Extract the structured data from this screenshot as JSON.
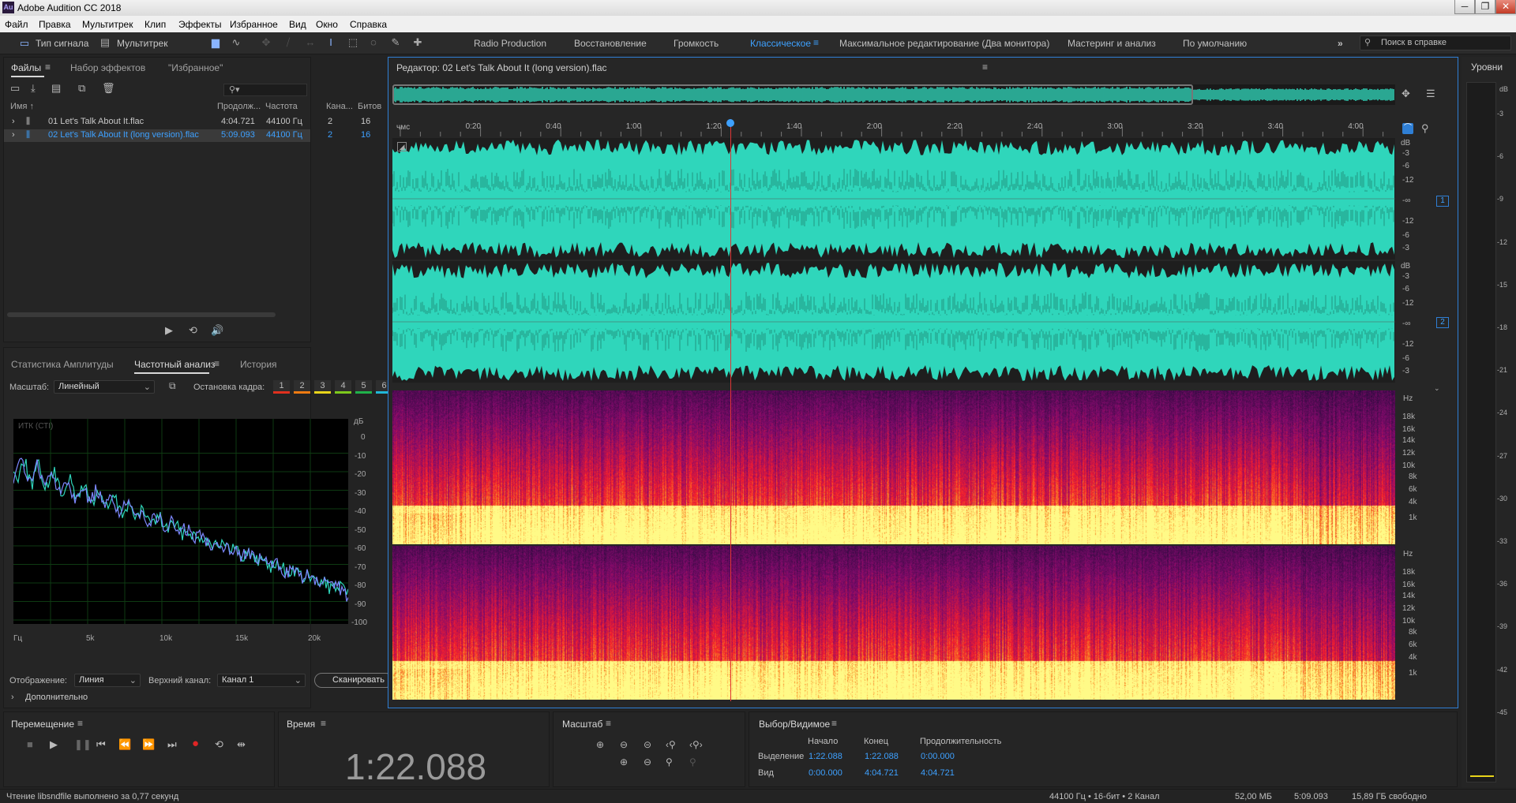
{
  "window": {
    "title": "Adobe Audition CC 2018",
    "app_icon": "Au"
  },
  "menu": [
    "Файл",
    "Правка",
    "Мультитрек",
    "Клип",
    "Эффекты",
    "Избранное",
    "Вид",
    "Окно",
    "Справка"
  ],
  "toolbar": {
    "waveform_label": "Тип сигнала",
    "multitrack_label": "Мультитрек",
    "workspaces": [
      "Radio Production",
      "Восстановление",
      "Громкость",
      "Классическое",
      "Максимальное редактирование (Два монитора)",
      "Мастеринг и анализ",
      "По умолчанию"
    ],
    "active_workspace": "Классическое",
    "search_placeholder": "Поиск в справке"
  },
  "files_panel": {
    "tabs": [
      "Файлы",
      "Набор эффектов",
      "\"Избранное\""
    ],
    "search_glyph": "⚲▾",
    "columns": [
      "Имя ↑",
      "Продолж...",
      "Частота",
      "Кана...",
      "Битов"
    ],
    "rows": [
      {
        "name": "01 Let's Talk About It.flac",
        "duration": "4:04.721",
        "rate": "44100 Гц",
        "channels": "2",
        "bits": "16"
      },
      {
        "name": "02 Let's Talk About It (long version).flac",
        "duration": "5:09.093",
        "rate": "44100 Гц",
        "channels": "2",
        "bits": "16"
      }
    ]
  },
  "analysis_panel": {
    "tabs": [
      "Статистика Амплитуды",
      "Частотный анализ",
      "История"
    ],
    "scale_label": "Масштаб:",
    "scale_value": "Линейный",
    "hold_label": "Остановка кадра:",
    "hold_buttons": [
      "1",
      "2",
      "3",
      "4",
      "5",
      "6"
    ],
    "hold_colors": [
      "#e0301e",
      "#ee7a12",
      "#e8d41a",
      "#7dc91c",
      "#20b24a",
      "#21b7d8"
    ],
    "graph_label": "ИТК (СТI)",
    "db_unit": "дБ",
    "db_ticks": [
      "0",
      "-10",
      "-20",
      "-30",
      "-40",
      "-50",
      "-60",
      "-70",
      "-80",
      "-90",
      "-100"
    ],
    "hz_ticks": [
      "Гц",
      "5k",
      "10k",
      "15k",
      "20k"
    ],
    "display_label": "Отображение:",
    "display_value": "Линия",
    "channel_label": "Верхний канал:",
    "channel_value": "Канал 1",
    "scan_button": "Сканировать",
    "advanced_label": "Дополнительно"
  },
  "editor": {
    "title": "Редактор: 02 Let's Talk About It (long version).flac",
    "time_unit": "чмс",
    "time_ticks": [
      "0:20",
      "0:40",
      "1:00",
      "1:20",
      "1:40",
      "2:00",
      "2:20",
      "2:40",
      "3:00",
      "3:20",
      "3:40",
      "4:00"
    ],
    "db_unit": "dB",
    "db_ticks": [
      "-3",
      "-6",
      "-12",
      "-∞",
      "-12",
      "-6",
      "-3"
    ],
    "channel_badges": [
      "1",
      "2"
    ],
    "hz_unit": "Hz",
    "hz_ticks": [
      "18k",
      "16k",
      "14k",
      "12k",
      "10k",
      "8k",
      "6k",
      "4k",
      "1k"
    ],
    "waveform_color": "#2fd6bb",
    "playhead_fraction": 0.337
  },
  "levels": {
    "title": "Уровни",
    "ticks": [
      "dB",
      "-3",
      "-6",
      "-9",
      "-12",
      "-15",
      "-18",
      "-21",
      "-24",
      "-27",
      "-30",
      "-33",
      "-36",
      "-39",
      "-42",
      "-45"
    ]
  },
  "transport": {
    "title": "Перемещение",
    "buttons": [
      "stop",
      "play",
      "pause",
      "go-start",
      "rewind",
      "fast-forward",
      "go-end",
      "record",
      "loop",
      "skip"
    ]
  },
  "time_panel": {
    "title": "Время",
    "value": "1:22.088"
  },
  "zoom_panel": {
    "title": "Масштаб"
  },
  "selection_panel": {
    "title": "Выбор/Видимое",
    "col_start": "Начало",
    "col_end": "Конец",
    "col_duration": "Продолжительность",
    "sel_label": "Выделение",
    "sel_start": "1:22.088",
    "sel_end": "1:22.088",
    "sel_duration": "0:00.000",
    "view_label": "Вид",
    "view_start": "0:00.000",
    "view_end": "4:04.721",
    "view_duration": "4:04.721"
  },
  "status": {
    "message": "Чтение libsndfile выполнено за 0,77 секунд",
    "format": "44100 Гц • 16-бит • 2 Канал",
    "size": "52,00 МБ",
    "duration": "5:09.093",
    "free": "15,89 ГБ свободно"
  }
}
